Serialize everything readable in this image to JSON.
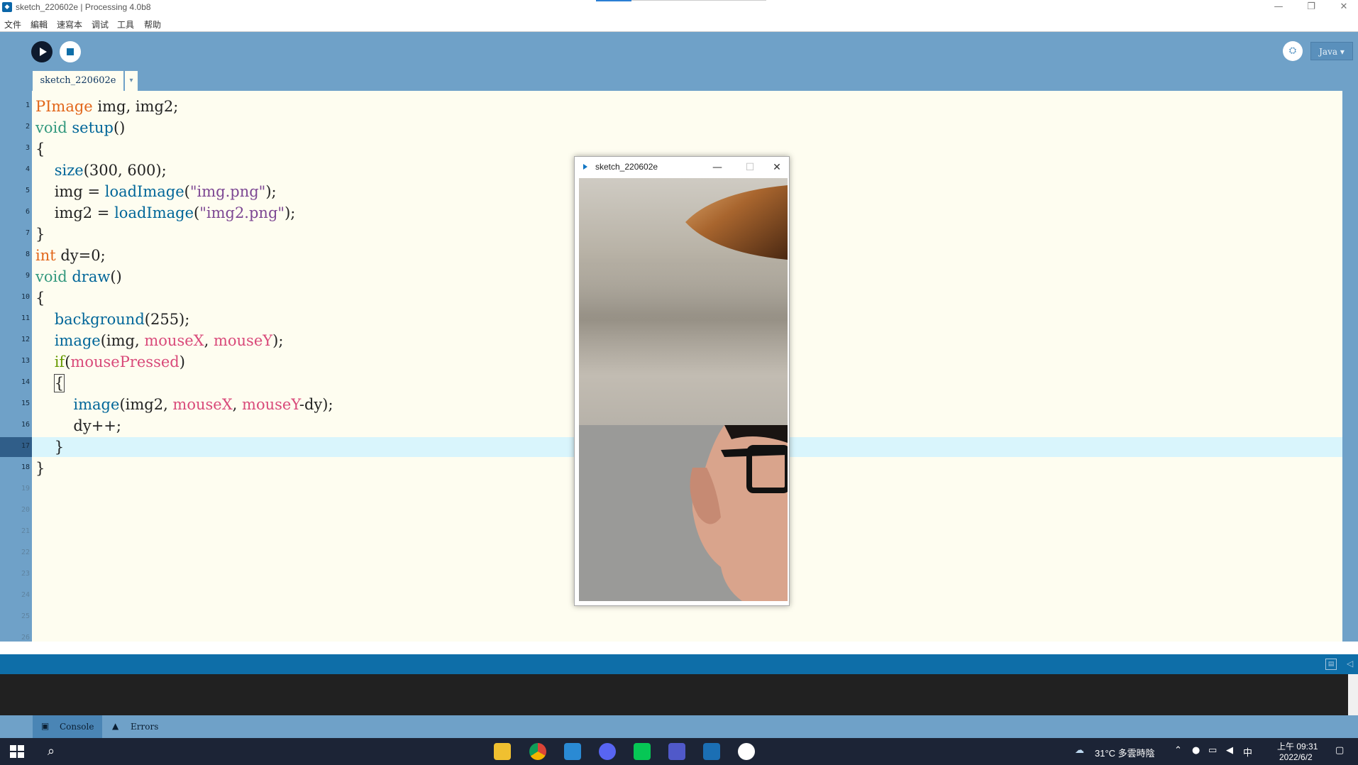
{
  "window": {
    "title": "sketch_220602e | Processing 4.0b8",
    "controls": {
      "minimize": "—",
      "maximize": "❐",
      "close": "✕"
    }
  },
  "menu": [
    "文件",
    "編輯",
    "速寫本",
    "调试",
    "工具",
    "帮助"
  ],
  "toolbar": {
    "debug_icon": "bug-icon",
    "mode": "Java ▾"
  },
  "tabs": {
    "active": "sketch_220602e",
    "menu_glyph": "▾"
  },
  "editor": {
    "line_numbers": [
      "1",
      "2",
      "3",
      "4",
      "5",
      "6",
      "7",
      "8",
      "9",
      "10",
      "11",
      "12",
      "13",
      "14",
      "15",
      "16",
      "17",
      "18",
      "19",
      "20",
      "21",
      "22",
      "23",
      "24",
      "25",
      "26"
    ],
    "current_line": 17,
    "code": [
      [
        {
          "t": "PImage",
          "c": "kw-type"
        },
        {
          "t": " img, img2;"
        }
      ],
      [
        {
          "t": "void",
          "c": "kw-void"
        },
        {
          "t": " "
        },
        {
          "t": "setup",
          "c": "fn"
        },
        {
          "t": "()"
        }
      ],
      [
        {
          "t": "{"
        }
      ],
      [
        {
          "t": "    "
        },
        {
          "t": "size",
          "c": "fn"
        },
        {
          "t": "(300, 600);"
        }
      ],
      [
        {
          "t": "    img = "
        },
        {
          "t": "loadImage",
          "c": "fn"
        },
        {
          "t": "("
        },
        {
          "t": "\"img.png\"",
          "c": "str"
        },
        {
          "t": ");"
        }
      ],
      [
        {
          "t": "    img2 = "
        },
        {
          "t": "loadImage",
          "c": "fn"
        },
        {
          "t": "("
        },
        {
          "t": "\"img2.png\"",
          "c": "str"
        },
        {
          "t": ");"
        }
      ],
      [
        {
          "t": "}"
        }
      ],
      [
        {
          "t": "int",
          "c": "kw-type"
        },
        {
          "t": " dy=0;"
        }
      ],
      [
        {
          "t": "void",
          "c": "kw-void"
        },
        {
          "t": " "
        },
        {
          "t": "draw",
          "c": "fn"
        },
        {
          "t": "()"
        }
      ],
      [
        {
          "t": "{"
        }
      ],
      [
        {
          "t": "    "
        },
        {
          "t": "background",
          "c": "fn"
        },
        {
          "t": "(255);"
        }
      ],
      [
        {
          "t": "    "
        },
        {
          "t": "image",
          "c": "fn"
        },
        {
          "t": "(img, "
        },
        {
          "t": "mouseX",
          "c": "var"
        },
        {
          "t": ", "
        },
        {
          "t": "mouseY",
          "c": "var"
        },
        {
          "t": ");"
        }
      ],
      [
        {
          "t": "    "
        },
        {
          "t": "if",
          "c": "kw-if"
        },
        {
          "t": "("
        },
        {
          "t": "mousePressed",
          "c": "var"
        },
        {
          "t": ")"
        }
      ],
      [
        {
          "t": "    "
        },
        {
          "t": "{",
          "c": "cursor"
        }
      ],
      [
        {
          "t": "        "
        },
        {
          "t": "image",
          "c": "fn"
        },
        {
          "t": "(img2, "
        },
        {
          "t": "mouseX",
          "c": "var"
        },
        {
          "t": ", "
        },
        {
          "t": "mouseY",
          "c": "var"
        },
        {
          "t": "-dy);"
        }
      ],
      [
        {
          "t": "        dy++;"
        }
      ],
      [
        {
          "t": "    }"
        }
      ],
      [
        {
          "t": "}"
        }
      ]
    ]
  },
  "console": {
    "tabs": [
      "Console",
      "Errors"
    ],
    "icons": [
      "console-icon",
      "warning-icon"
    ]
  },
  "sketch_window": {
    "title": "sketch_220602e",
    "controls": {
      "minimize": "—",
      "maximize": "☐",
      "close": "✕"
    }
  },
  "taskbar": {
    "weather": "31°C  多雲時陰",
    "ime": "中",
    "time": "上午 09:31",
    "date": "2022/6/2",
    "apps": [
      "file-explorer-icon",
      "chrome-icon",
      "outlook-icon",
      "discord-icon",
      "line-icon",
      "teams-icon",
      "processing-icon",
      "processing-run-icon"
    ],
    "colors": {
      "bg": "#1c2436",
      "accent": "#0e6ea8"
    }
  }
}
